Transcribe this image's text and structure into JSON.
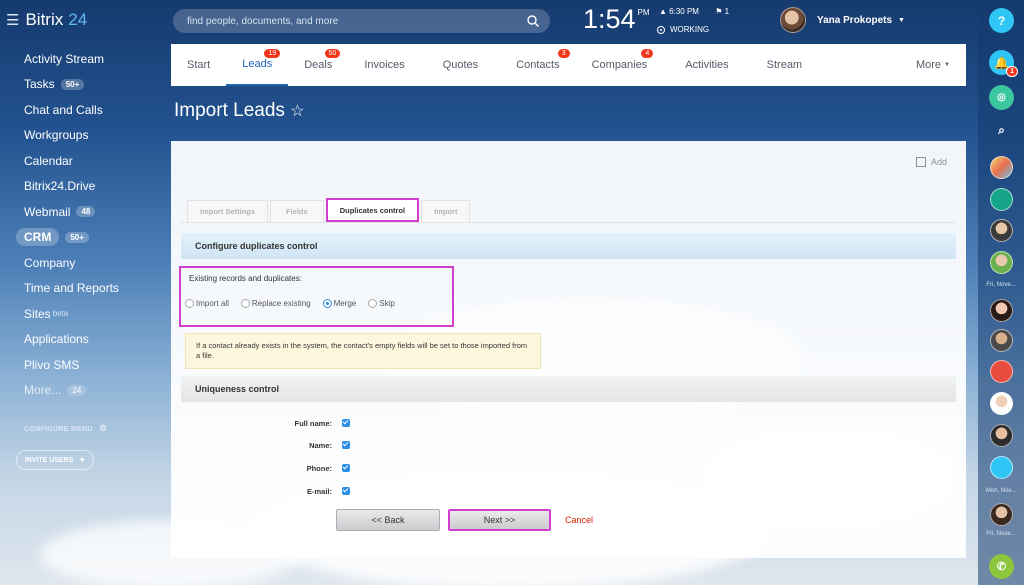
{
  "app": {
    "name": "Bitrix",
    "version": "24"
  },
  "sidebar": {
    "items": [
      {
        "label": "Activity Stream",
        "badge": ""
      },
      {
        "label": "Tasks",
        "badge": "50+"
      },
      {
        "label": "Chat and Calls",
        "badge": ""
      },
      {
        "label": "Workgroups",
        "badge": ""
      },
      {
        "label": "Calendar",
        "badge": ""
      },
      {
        "label": "Bitrix24.Drive",
        "badge": ""
      },
      {
        "label": "Webmail",
        "badge": "48"
      },
      {
        "label": "CRM",
        "badge": "50+"
      },
      {
        "label": "Company",
        "badge": ""
      },
      {
        "label": "Time and Reports",
        "badge": ""
      },
      {
        "label": "Sites",
        "badge": ""
      },
      {
        "label": "Applications",
        "badge": ""
      },
      {
        "label": "Plivo SMS",
        "badge": ""
      },
      {
        "label": "More...",
        "badge": "24"
      }
    ],
    "sites_beta": "beta",
    "configure_menu": "CONFIGURE MENU",
    "invite_users": "INVITE USERS"
  },
  "header": {
    "search_placeholder": "find people, documents, and more",
    "clock_time": "1:54",
    "clock_ampm": "PM",
    "alarm_time": "6:30 PM",
    "flag_count": "1",
    "status": "WORKING",
    "user_name": "Yana Prokopets"
  },
  "tabs": [
    {
      "label": "Start",
      "count": ""
    },
    {
      "label": "Leads",
      "count": "19"
    },
    {
      "label": "Deals",
      "count": "50"
    },
    {
      "label": "Invoices",
      "count": ""
    },
    {
      "label": "Quotes",
      "count": ""
    },
    {
      "label": "Contacts",
      "count": "3"
    },
    {
      "label": "Companies",
      "count": "4"
    },
    {
      "label": "Activities",
      "count": ""
    },
    {
      "label": "Stream",
      "count": ""
    },
    {
      "label": "More",
      "count": ""
    }
  ],
  "page_title": "Import Leads",
  "panel": {
    "add_label": "Add",
    "subtabs": [
      "Import Settings",
      "Fields",
      "Duplicates control",
      "Import"
    ],
    "section_dup": "Configure duplicates control",
    "dup_label": "Existing records and duplicates:",
    "radios": [
      "Import all",
      "Replace existing",
      "Merge",
      "Skip"
    ],
    "selected_radio": "Merge",
    "note": "If a contact already exists in the system, the contact's empty fields will be set to those imported from a file.",
    "section_uniq": "Uniqueness control",
    "uniqueness": [
      {
        "label": "Full name:",
        "checked": true
      },
      {
        "label": "Name:",
        "checked": true
      },
      {
        "label": "Phone:",
        "checked": true
      },
      {
        "label": "E-mail:",
        "checked": true
      }
    ],
    "back_label": "<< Back",
    "next_label": "Next >>",
    "cancel_label": "Cancel"
  },
  "rightbar": {
    "help": "?",
    "notif_count": "1",
    "date_labels": [
      "Fri, Nove...",
      "Mon, Nov...",
      "Fri, Nove..."
    ]
  },
  "colors": {
    "accent": "#2067b0",
    "highlight": "#d23fcf",
    "counter": "#f0371b"
  }
}
